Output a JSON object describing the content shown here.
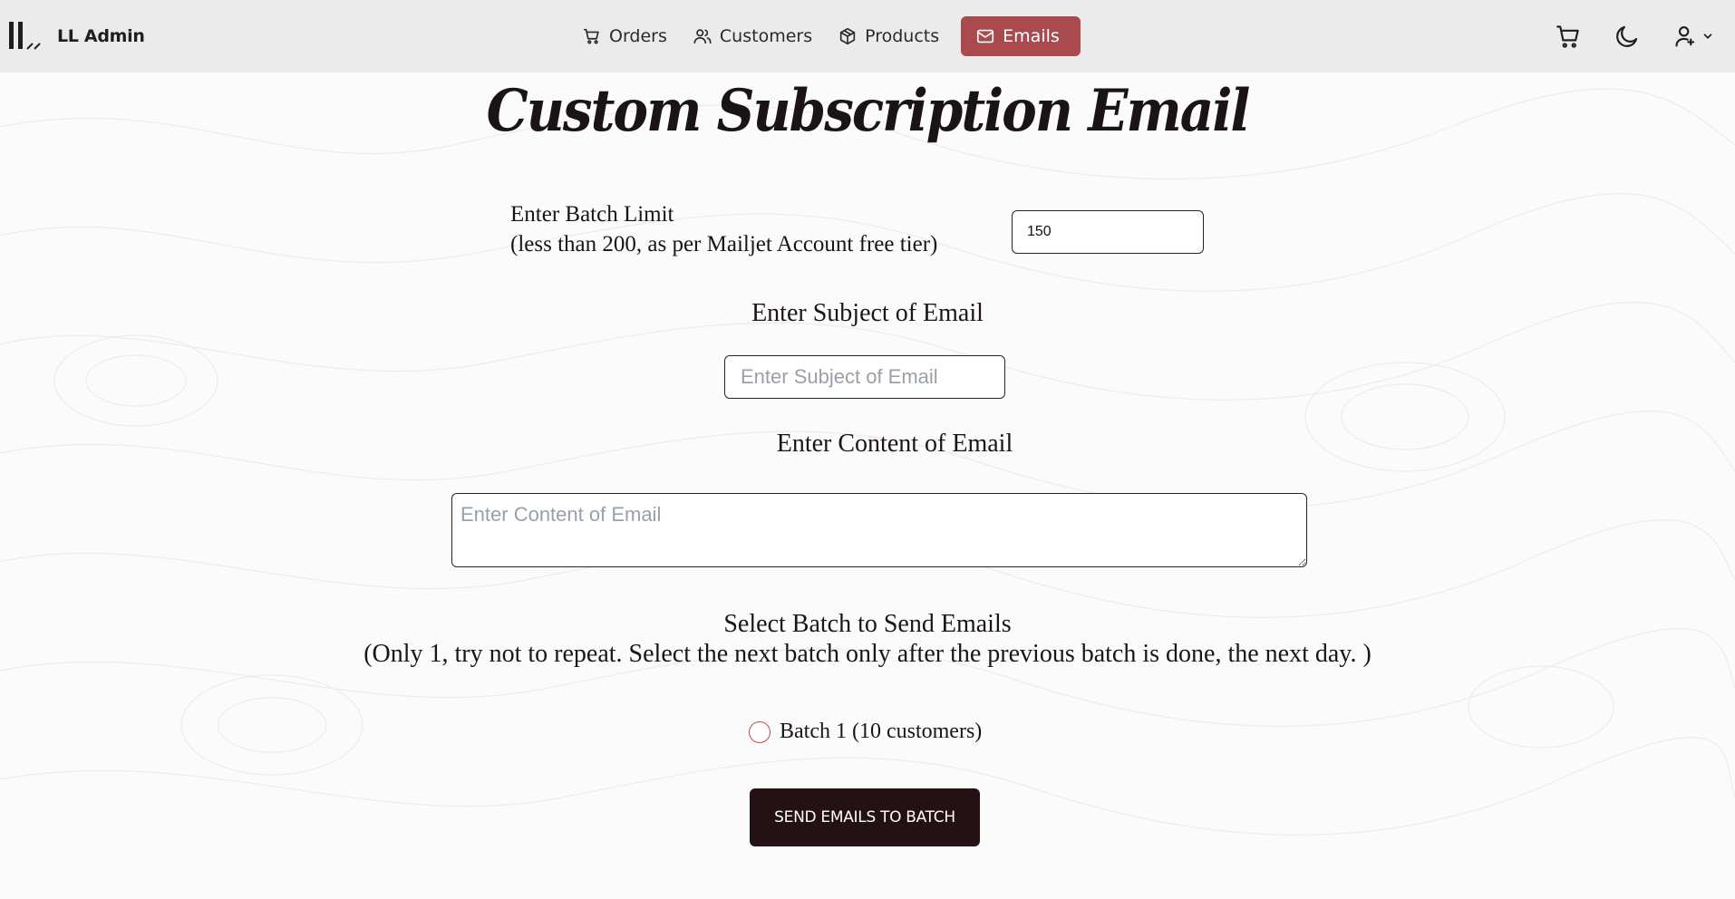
{
  "brand": {
    "name": "LL Admin",
    "logo_icon": "ll-logo-icon"
  },
  "nav": {
    "links": [
      {
        "label": "Orders",
        "icon": "cart-icon",
        "active": false
      },
      {
        "label": "Customers",
        "icon": "users-icon",
        "active": false
      },
      {
        "label": "Products",
        "icon": "box-icon",
        "active": false
      },
      {
        "label": "Emails",
        "icon": "mail-icon",
        "active": true
      }
    ],
    "right_icons": [
      "cart-icon",
      "moon-icon",
      "user-settings-icon",
      "chevron-down-icon"
    ]
  },
  "page": {
    "title": "Custom Subscription Email"
  },
  "form": {
    "batch_limit": {
      "label_line1": "Enter Batch Limit",
      "label_line2": "(less than 200, as per Mailjet Account free tier)",
      "value": "150"
    },
    "subject": {
      "label": "Enter Subject of Email",
      "placeholder": "Enter Subject of Email",
      "value": ""
    },
    "content": {
      "label": "Enter Content of Email",
      "placeholder": "Enter Content of Email",
      "value": ""
    },
    "batch_select": {
      "label_line1": "Select Batch to Send Emails",
      "label_line2": "(Only 1, try not to repeat. Select the next batch only after the previous batch is done, the next day. )",
      "options": [
        {
          "label": "Batch 1 (10 customers)",
          "selected": false
        }
      ]
    },
    "submit_label": "SEND EMAILS TO BATCH"
  },
  "colors": {
    "navbar_bg": "#ebebeb",
    "active_nav": "#a84a4e",
    "primary_button": "#231113",
    "radio_border": "#c04a52",
    "background": "#fbfbfb"
  }
}
